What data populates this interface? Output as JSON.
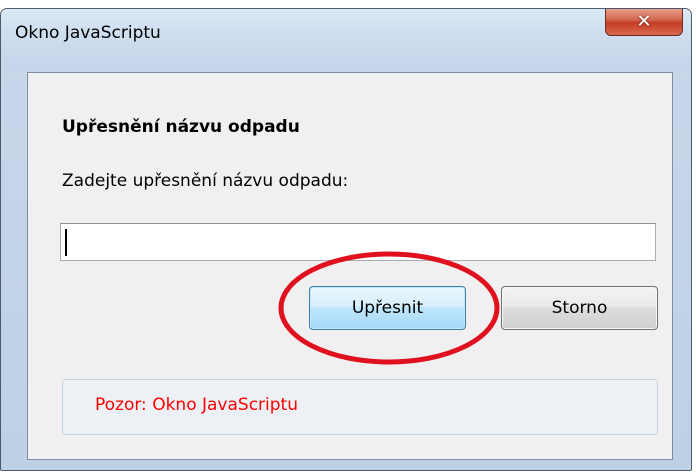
{
  "window": {
    "title": "Okno JavaScriptu",
    "close_icon": "close-icon"
  },
  "dialog": {
    "heading": "Upřesnění názvu odpadu",
    "prompt": "Zadejte upřesnění názvu odpadu:",
    "input_value": "",
    "ok_label": "Upřesnit",
    "cancel_label": "Storno",
    "warning": "Pozor: Okno JavaScriptu"
  },
  "colors": {
    "annotation_ellipse": "#e0101e",
    "warning_text": "#ff0000"
  }
}
